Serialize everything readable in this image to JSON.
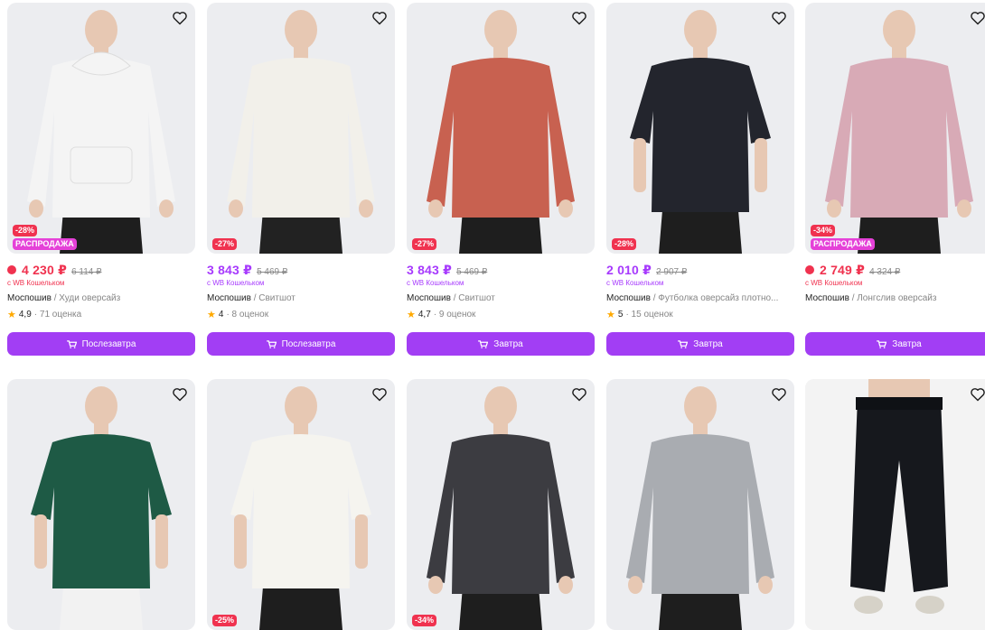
{
  "products": [
    {
      "price": "4 230 ₽",
      "old_price": "6 114 ₽",
      "wallet": "с WB Кошельком",
      "brand": "Моспошив",
      "name": "/ Худи оверсайз",
      "rating": "4,9",
      "reviews": "· 71 оценка",
      "discount": "-28%",
      "promo": "РАСПРОДАЖА",
      "button": "Послезавтра",
      "red": true,
      "garment": "hoodie",
      "color": "#f4f4f4",
      "pants": "#1e1e1e"
    },
    {
      "price": "3 843 ₽",
      "old_price": "5 469 ₽",
      "wallet": "с WB Кошельком",
      "brand": "Моспошив",
      "name": "/ Свитшот",
      "rating": "4",
      "reviews": "· 8 оценок",
      "discount": "-27%",
      "promo": "",
      "button": "Послезавтра",
      "red": false,
      "garment": "sweat",
      "color": "#f2f0ea",
      "pants": "#222222"
    },
    {
      "price": "3 843 ₽",
      "old_price": "5 469 ₽",
      "wallet": "с WB Кошельком",
      "brand": "Моспошив",
      "name": "/ Свитшот",
      "rating": "4,7",
      "reviews": "· 9 оценок",
      "discount": "-27%",
      "promo": "",
      "button": "Завтра",
      "red": false,
      "garment": "sweat",
      "color": "#c86150",
      "pants": "#1e1e1e"
    },
    {
      "price": "2 010 ₽",
      "old_price": "2 907 ₽",
      "wallet": "с WB Кошельком",
      "brand": "Моспошив",
      "name": "/ Футболка оверсайз плотно...",
      "rating": "5",
      "reviews": "· 15 оценок",
      "discount": "-28%",
      "promo": "",
      "button": "Завтра",
      "red": false,
      "garment": "tee",
      "color": "#23252d",
      "pants": "#1e1e1e"
    },
    {
      "price": "2 749 ₽",
      "old_price": "4 324 ₽",
      "wallet": "с WB Кошельком",
      "brand": "Моспошив",
      "name": "/ Лонгслив оверсайз",
      "rating": "",
      "reviews": "",
      "discount": "-34%",
      "promo": "РАСПРОДАЖА",
      "button": "Завтра",
      "red": true,
      "garment": "sweat",
      "color": "#d8aab6",
      "pants": "#1e1e1e"
    },
    {
      "discount": "",
      "promo": "",
      "garment": "tee",
      "color": "#1e5a45",
      "pants": "#f2f2f2"
    },
    {
      "discount": "-25%",
      "promo": "",
      "garment": "tee",
      "color": "#f5f4ef",
      "pants": "#1e1e1e"
    },
    {
      "discount": "-34%",
      "promo": "",
      "garment": "sweat",
      "color": "#3c3c41",
      "pants": "#1e1e1e"
    },
    {
      "discount": "",
      "promo": "",
      "garment": "sweat",
      "color": "#a9acb1",
      "pants": "#1e1e1e"
    },
    {
      "discount": "",
      "promo": "",
      "garment": "pants",
      "color": "#ffffff",
      "pants": "#16181d"
    }
  ]
}
